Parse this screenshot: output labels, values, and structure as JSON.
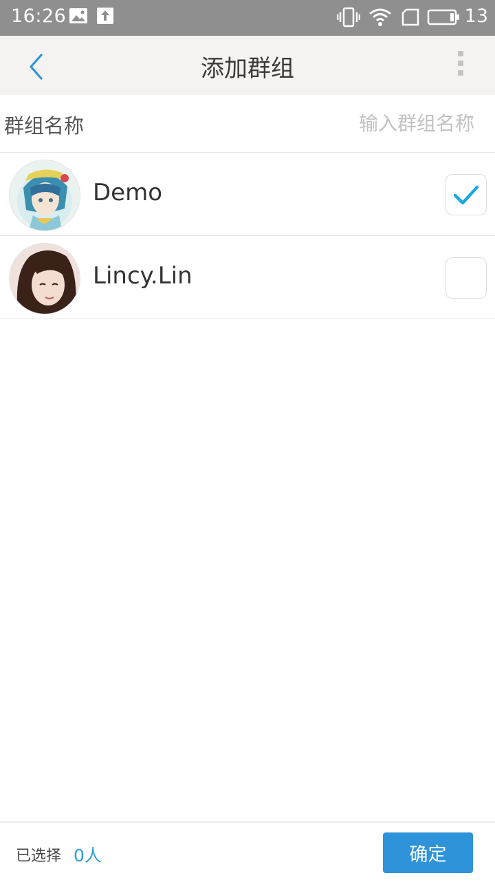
{
  "status_bar": {
    "time": "16:26",
    "battery_level": "13",
    "icons": [
      "image-icon",
      "upload-icon",
      "vibrate-icon",
      "wifi-icon",
      "sim-icon",
      "battery-icon"
    ]
  },
  "app_bar": {
    "title": "添加群组",
    "back_icon": "chevron-left-icon",
    "more_icon": "more-vertical-icon"
  },
  "group_name": {
    "label": "群组名称",
    "placeholder": "输入群组名称",
    "value": ""
  },
  "contacts": [
    {
      "name": "Demo",
      "checked": true,
      "avatar": "anime-girl-avatar"
    },
    {
      "name": "Lincy.Lin",
      "checked": false,
      "avatar": "woman-portrait-avatar"
    }
  ],
  "footer": {
    "selected_label": "已选择",
    "selected_count": "0人",
    "confirm_label": "确定"
  },
  "colors": {
    "accent": "#2e93d8",
    "check": "#1ba8e0",
    "status_bar": "#8f8f8f",
    "app_bar": "#f5f3f1"
  }
}
